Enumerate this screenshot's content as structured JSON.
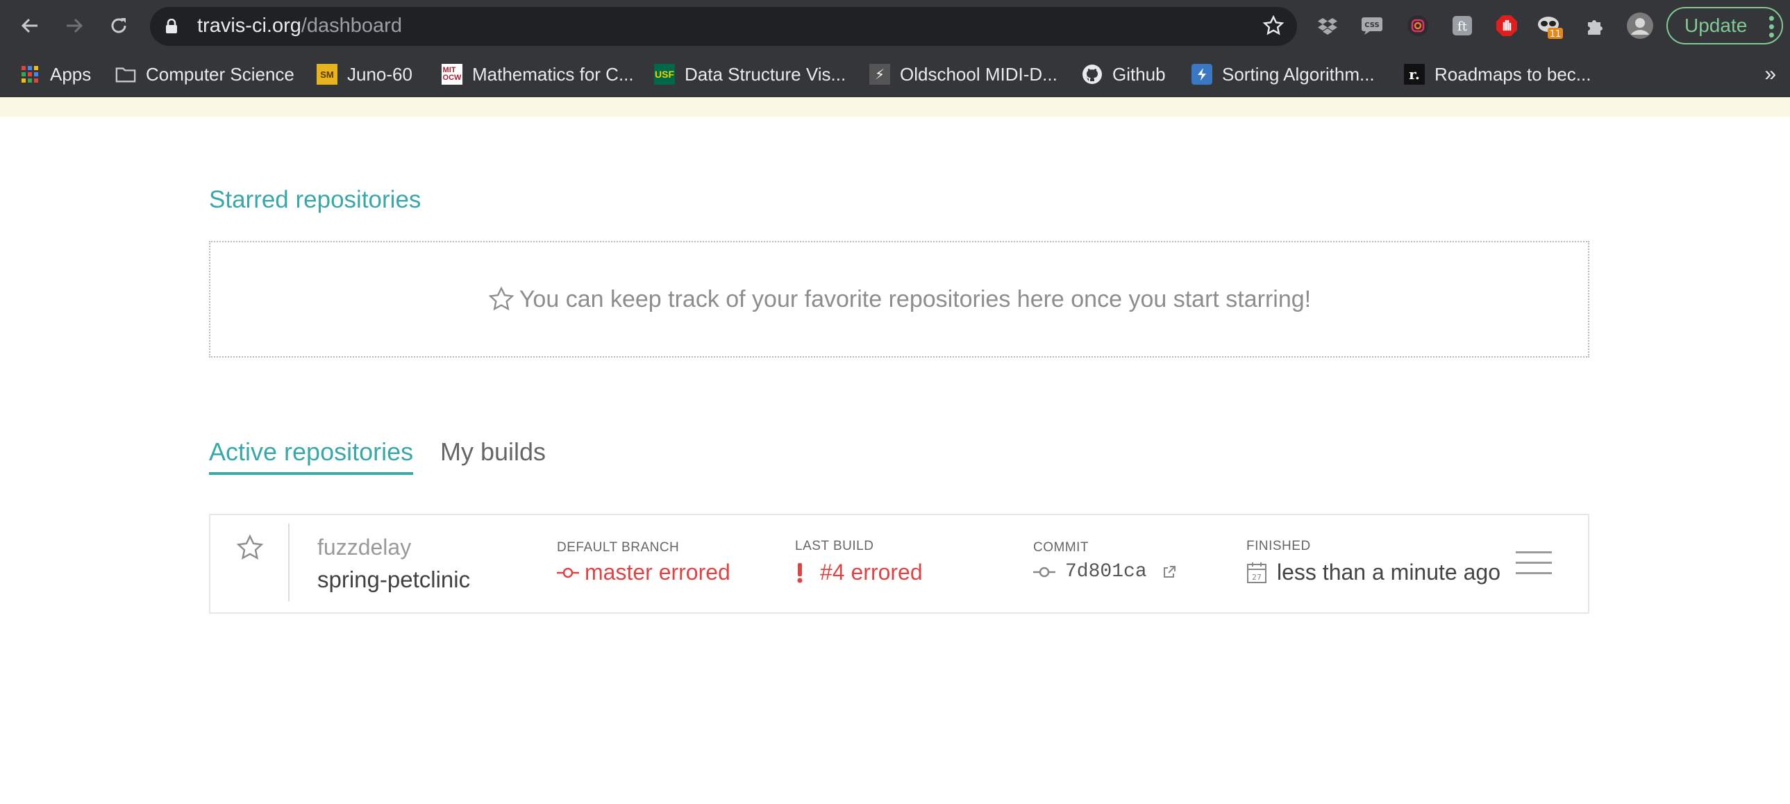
{
  "browser": {
    "url_host": "travis-ci.org",
    "url_path": "/dashboard",
    "update_label": "Update",
    "extension_badge": "11",
    "more_bookmarks": "»",
    "bookmarks": [
      {
        "label": "Apps"
      },
      {
        "label": "Computer Science"
      },
      {
        "label": "Juno-60"
      },
      {
        "label": "Mathematics for C..."
      },
      {
        "label": "Data Structure Vis..."
      },
      {
        "label": "Oldschool MIDI-D..."
      },
      {
        "label": "Github"
      },
      {
        "label": "Sorting Algorithm..."
      },
      {
        "label": "Roadmaps to bec..."
      }
    ]
  },
  "starred": {
    "title": "Starred repositories",
    "empty_message": "You can keep track of your favorite repositories here once you start starring!"
  },
  "tabs": [
    {
      "label": "Active repositories",
      "active": true
    },
    {
      "label": "My builds",
      "active": false
    }
  ],
  "repo": {
    "owner": "fuzzdelay",
    "name": "spring-petclinic",
    "default_branch_label": "DEFAULT BRANCH",
    "default_branch_value": "master errored",
    "last_build_label": "LAST BUILD",
    "last_build_value": "#4 errored",
    "commit_label": "COMMIT",
    "commit_value": "7d801ca",
    "finished_label": "FINISHED",
    "finished_value": "less than a minute ago",
    "calendar_day": "27"
  },
  "colors": {
    "accent": "#3aa7a9",
    "error": "#db4545",
    "chrome": "#35363a"
  }
}
